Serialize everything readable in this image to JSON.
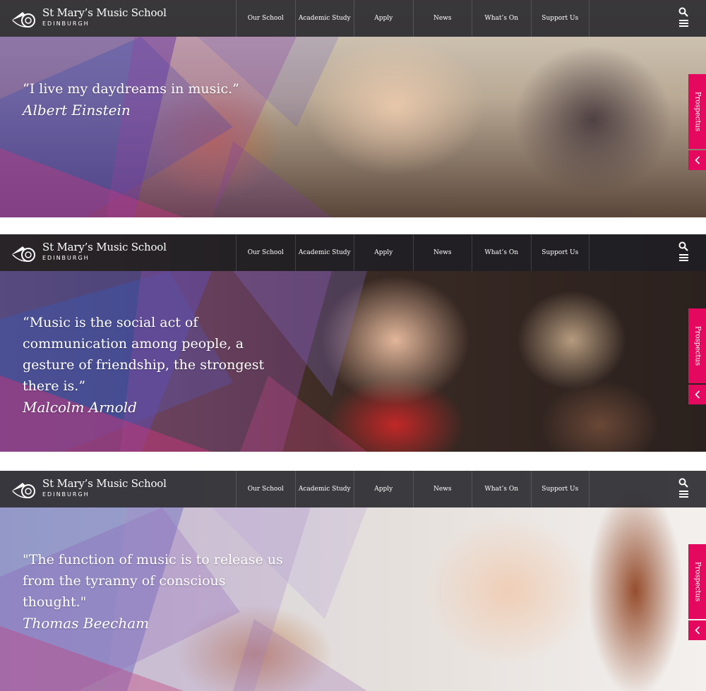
{
  "brand": {
    "name": "St Mary’s Music School",
    "location": "EDINBURGH",
    "accent_color": "#e4095e",
    "nav_background": "#1e1e24"
  },
  "nav": {
    "items": [
      {
        "label": "Our School"
      },
      {
        "label": "Academic Study"
      },
      {
        "label": "Apply"
      },
      {
        "label": "News"
      },
      {
        "label": "What’s On"
      },
      {
        "label": "Support Us"
      }
    ],
    "search_icon": "search-icon",
    "menu_icon": "hamburger-menu-icon"
  },
  "side_tab": {
    "label": "Prospectus",
    "collapse_icon": "chevron-left-icon"
  },
  "slides": [
    {
      "quote_lines": [
        "“I live my daydreams in music.”"
      ],
      "author": "Albert Einstein"
    },
    {
      "quote_lines": [
        "“Music is the social act of",
        "communication among people, a",
        "gesture of friendship, the strongest",
        "there is.”"
      ],
      "author": "Malcolm Arnold"
    },
    {
      "quote_lines": [
        "\"The function of music is to release us",
        "from the tyranny of conscious",
        "thought.\""
      ],
      "author": "Thomas Beecham"
    }
  ]
}
